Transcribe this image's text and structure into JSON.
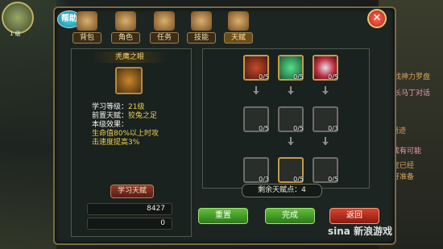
{
  "header": {
    "help_label": "帮助",
    "close_icon": "close-icon"
  },
  "tabs": [
    {
      "label": "背包",
      "icon": "backpack-icon"
    },
    {
      "label": "角色",
      "icon": "helmet-icon"
    },
    {
      "label": "任务",
      "icon": "scroll-icon"
    },
    {
      "label": "技能",
      "icon": "sword-icon"
    },
    {
      "label": "天赋",
      "icon": "talent-icon",
      "active": true
    }
  ],
  "detail": {
    "title": "秃鹰之眼",
    "learn_level_key": "学习等级：",
    "learn_level_val": "21级",
    "prereq_key": "前置天赋：",
    "prereq_val": "狡兔之足",
    "effect_label": "本级效果：",
    "effect_line1": "生命值80%以上时攻",
    "effect_line2": "击速度提高3%",
    "learn_button": "学习天赋"
  },
  "resources": {
    "gold": "8427",
    "diamond": "0"
  },
  "tree": {
    "rows": [
      [
        {
          "count": "0/5",
          "lit": true
        },
        {
          "count": "0/5",
          "lit": true
        },
        {
          "count": "0/5",
          "lit": true
        }
      ],
      [
        {
          "count": "0/5",
          "lit": false
        },
        {
          "count": "0/5",
          "lit": false
        },
        {
          "count": "0/3",
          "lit": false
        }
      ],
      [
        {
          "count": "0/3",
          "lit": false
        },
        {
          "count": "0/5",
          "lit": true
        },
        {
          "count": "0/5",
          "lit": false
        }
      ]
    ],
    "remaining": "剩余天赋点：4"
  },
  "buttons": {
    "reset": "重置",
    "done": "完成",
    "back": "返回"
  },
  "side": {
    "level": "1 级",
    "r1": "寻找神力罗盘",
    "r2": "村长马丁对话",
    "r3": "遗迹",
    "r4": "合成有可能",
    "r5": "宝宝已经",
    "r6": "做好准备"
  },
  "watermark": "sina 新浪游戏"
}
